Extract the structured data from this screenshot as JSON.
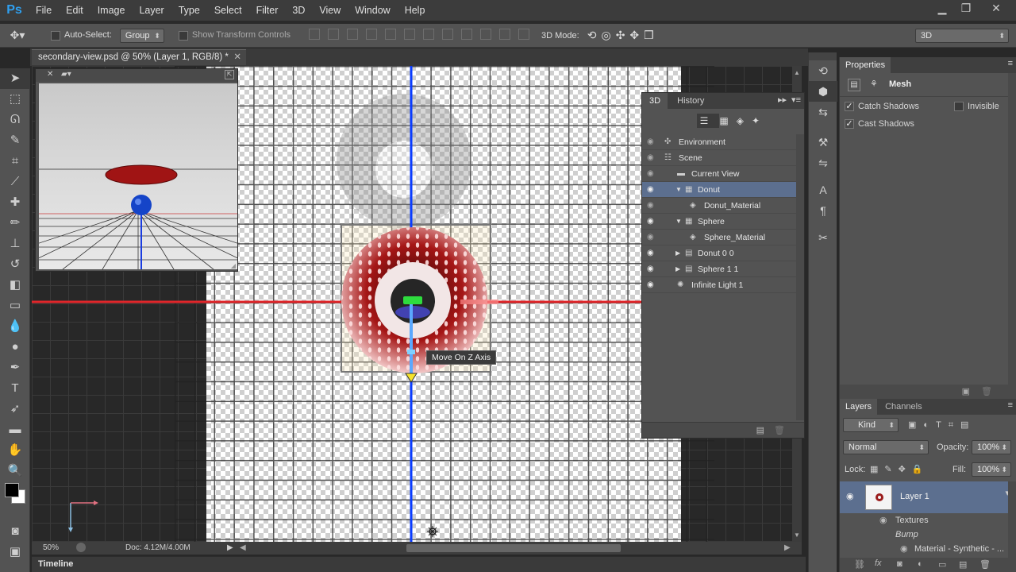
{
  "app": {
    "logo": "Ps"
  },
  "menu": [
    "File",
    "Edit",
    "Image",
    "Layer",
    "Type",
    "Select",
    "Filter",
    "3D",
    "View",
    "Window",
    "Help"
  ],
  "options": {
    "auto_select_label": "Auto-Select:",
    "auto_select_value": "Group",
    "show_transform_label": "Show Transform Controls",
    "mode_label": "3D Mode:",
    "workspace": "3D"
  },
  "document": {
    "tab_title": "secondary-view.psd @ 50% (Layer 1, RGB/8) *",
    "tooltip": "Move On Z Axis",
    "zoom": "50%",
    "doc_size": "Doc: 4.12M/4.00M"
  },
  "timeline_label": "Timeline",
  "panel3d": {
    "tabs": [
      "3D",
      "History"
    ],
    "rows": [
      {
        "label": "Environment",
        "indent": 0,
        "eye": false,
        "twisty": "",
        "selected": false,
        "icon": "✣"
      },
      {
        "label": "Scene",
        "indent": 0,
        "eye": false,
        "twisty": "",
        "selected": false,
        "icon": "☷"
      },
      {
        "label": "Current View",
        "indent": 1,
        "eye": false,
        "twisty": "",
        "selected": false,
        "icon": "▬"
      },
      {
        "label": "Donut",
        "indent": 1,
        "eye": true,
        "twisty": "▼",
        "selected": true,
        "icon": "▦"
      },
      {
        "label": "Donut_Material",
        "indent": 2,
        "eye": false,
        "twisty": "",
        "selected": false,
        "icon": "◈"
      },
      {
        "label": "Sphere",
        "indent": 1,
        "eye": true,
        "twisty": "▼",
        "selected": false,
        "icon": "▦"
      },
      {
        "label": "Sphere_Material",
        "indent": 2,
        "eye": false,
        "twisty": "",
        "selected": false,
        "icon": "◈"
      },
      {
        "label": "Donut 0 0",
        "indent": 1,
        "eye": true,
        "twisty": "▶",
        "selected": false,
        "icon": "▤"
      },
      {
        "label": "Sphere 1 1",
        "indent": 1,
        "eye": true,
        "twisty": "▶",
        "selected": false,
        "icon": "▤"
      },
      {
        "label": "Infinite Light 1",
        "indent": 1,
        "eye": true,
        "twisty": "",
        "selected": false,
        "icon": "✺"
      }
    ]
  },
  "properties": {
    "title": "Properties",
    "section": "Mesh",
    "catch_shadows": "Catch Shadows",
    "invisible": "Invisible",
    "cast_shadows": "Cast Shadows"
  },
  "layers": {
    "tabs": [
      "Layers",
      "Channels"
    ],
    "kind": "Kind",
    "blend_mode": "Normal",
    "opacity_label": "Opacity:",
    "opacity": "100%",
    "lock_label": "Lock:",
    "fill_label": "Fill:",
    "fill": "100%",
    "layer_name": "Layer 1",
    "textures": "Textures",
    "bump": "Bump",
    "material": "Material - Synthetic - ..."
  },
  "colors": {
    "accent_blue": "#0a3cff",
    "axis_red": "#e0262a",
    "selection": "#5c6f8f",
    "donut_red": "#8b1010"
  }
}
